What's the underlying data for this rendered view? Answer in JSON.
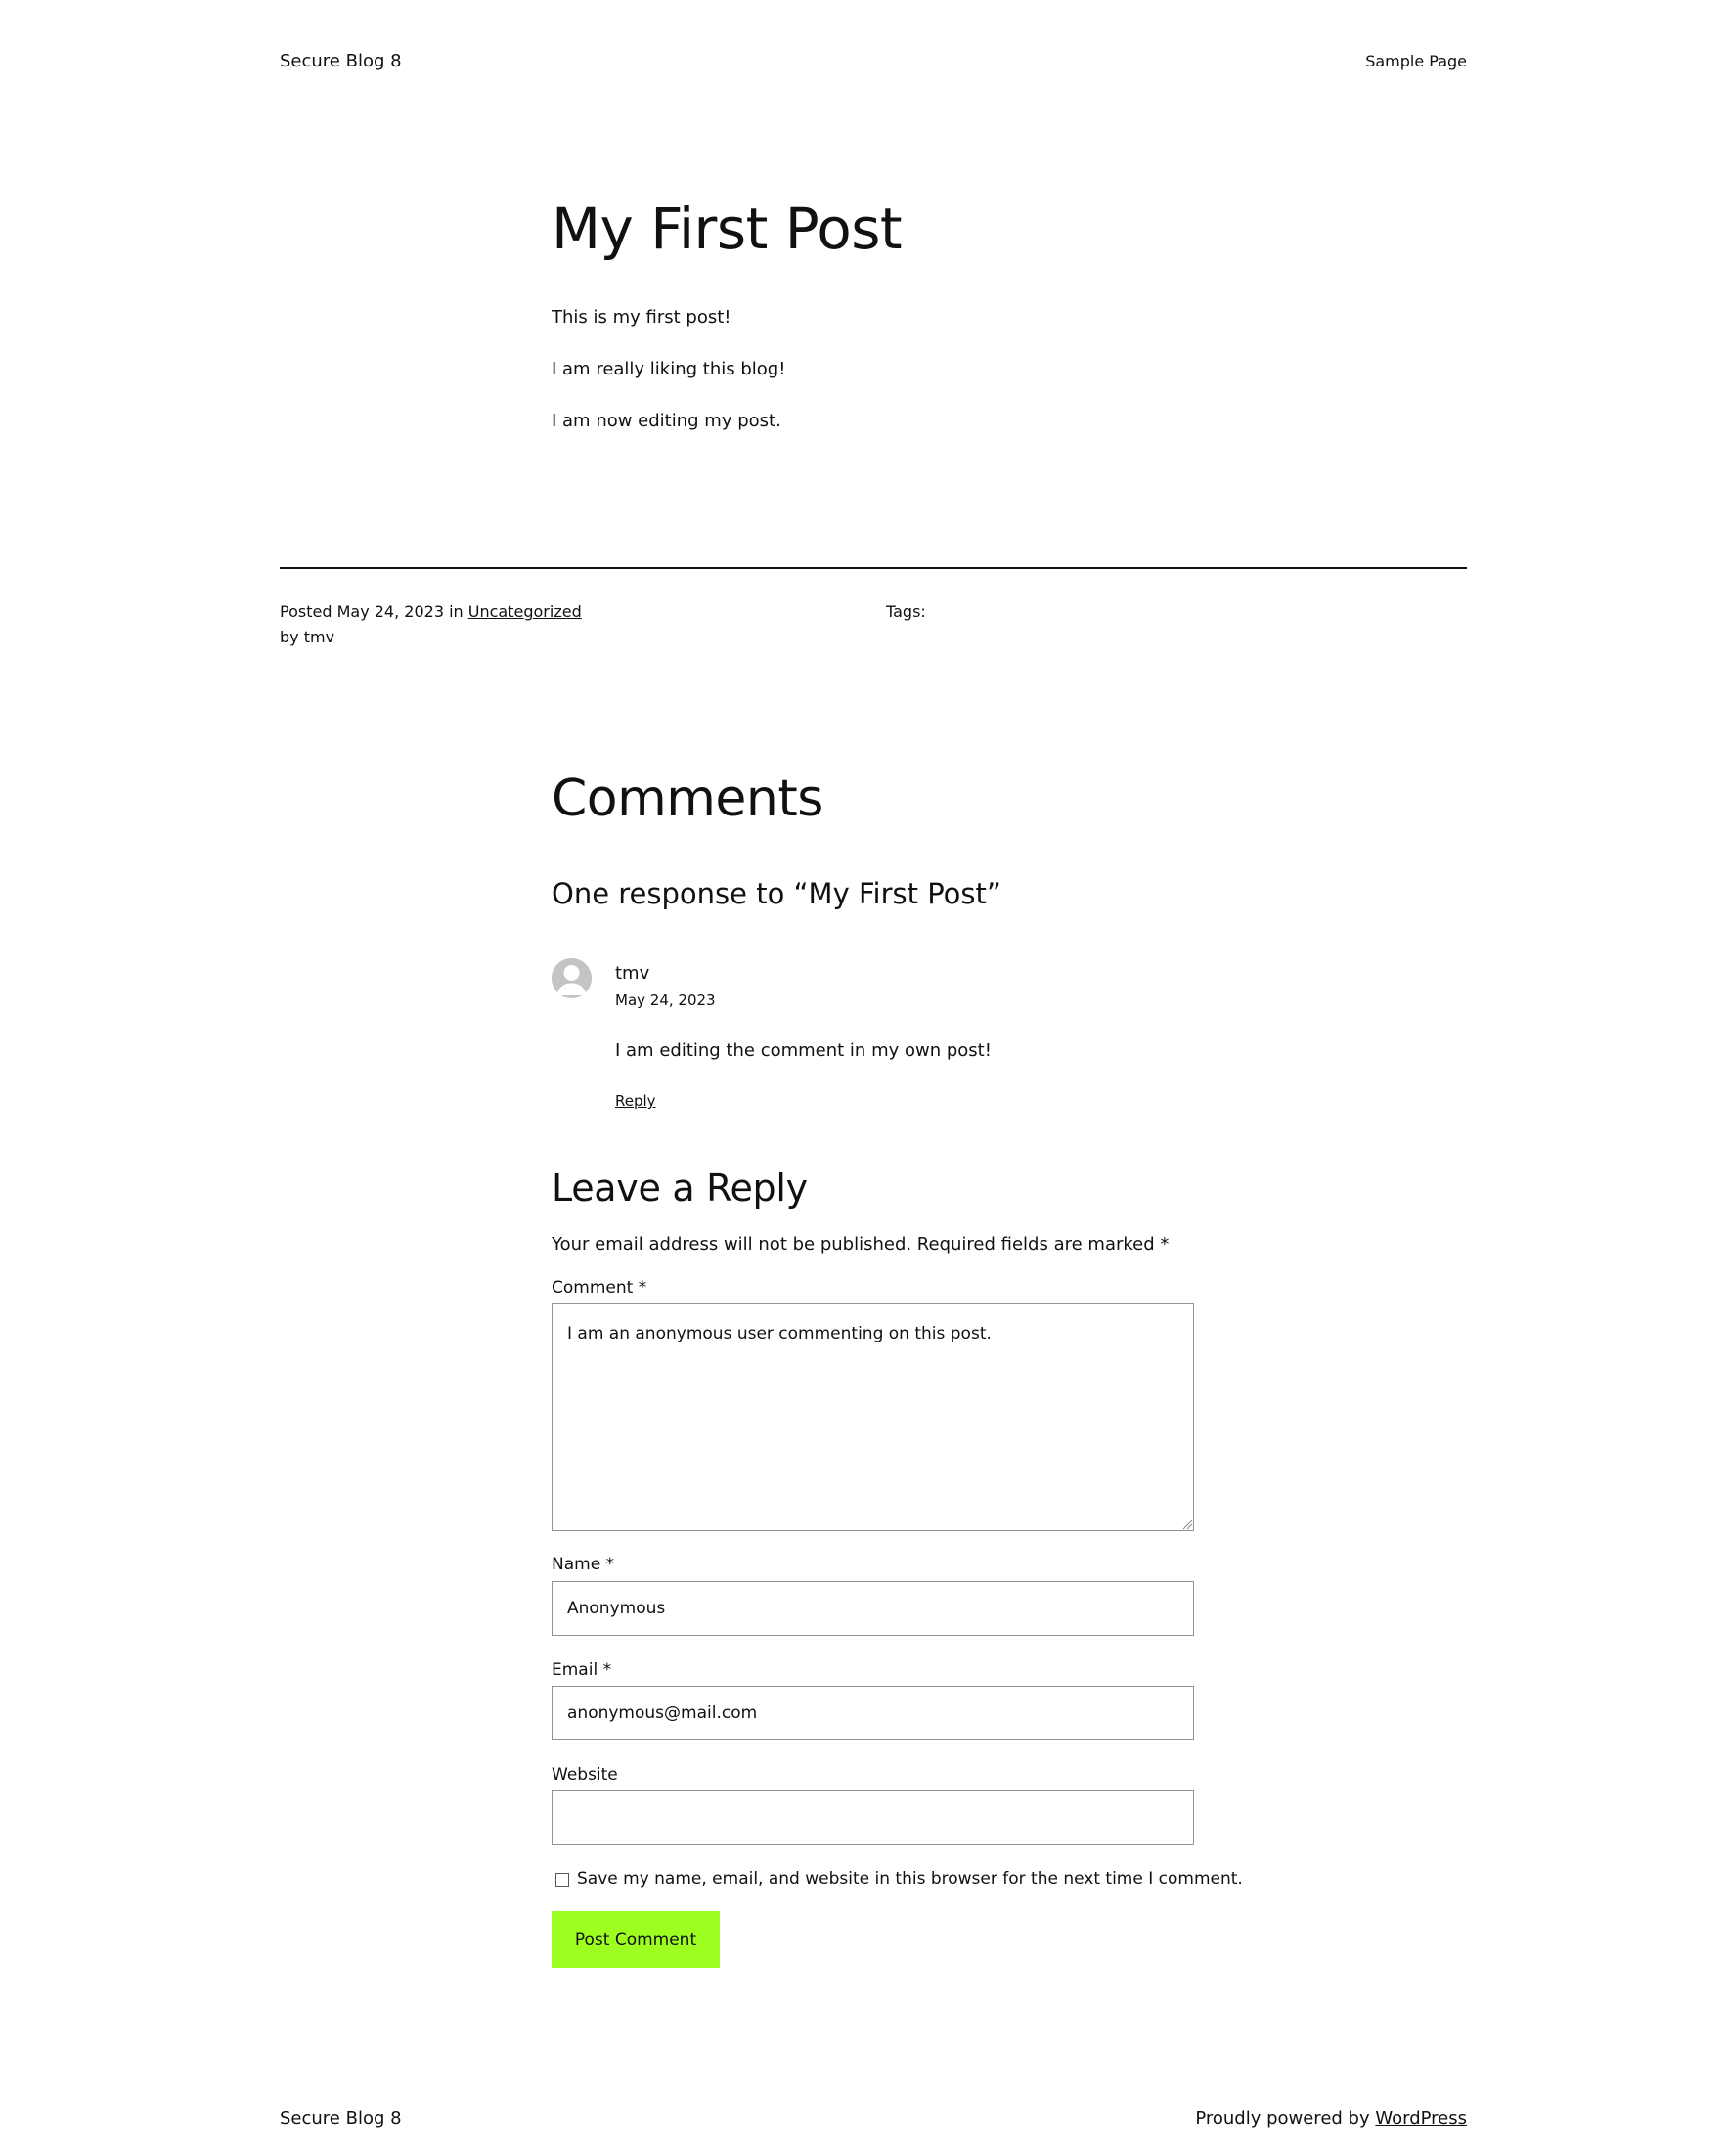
{
  "header": {
    "site_title": "Secure Blog 8",
    "nav": {
      "sample_page": "Sample Page"
    }
  },
  "post": {
    "title": "My First Post",
    "paragraphs": [
      "This is my first post!",
      "I am really liking this blog!",
      "I am now editing my post."
    ],
    "meta": {
      "posted_prefix": "Posted",
      "date": "May 24, 2023",
      "in": "in",
      "category": "Uncategorized",
      "by": "by",
      "author": "tmv",
      "tags_label": "Tags:"
    }
  },
  "comments": {
    "heading": "Comments",
    "count_heading": "One response to “My First Post”",
    "items": [
      {
        "author": "tmv",
        "date": "May 24, 2023",
        "text": "I am editing the comment in my own post!",
        "reply_label": "Reply"
      }
    ]
  },
  "reply_form": {
    "heading": "Leave a Reply",
    "notes": "Your email address will not be published. Required fields are marked *",
    "comment": {
      "label": "Comment *",
      "value": "I am an anonymous user commenting on this post."
    },
    "name": {
      "label": "Name *",
      "value": "Anonymous"
    },
    "email": {
      "label": "Email *",
      "value": "anonymous@mail.com"
    },
    "website": {
      "label": "Website",
      "value": ""
    },
    "save_info": {
      "label": "Save my name, email, and website in this browser for the next time I comment.",
      "checked": false
    },
    "submit_label": "Post Comment",
    "submit_color": "#9dff20"
  },
  "footer": {
    "site_title": "Secure Blog 8",
    "credit_prefix": "Proudly powered by",
    "credit_link": "WordPress"
  }
}
